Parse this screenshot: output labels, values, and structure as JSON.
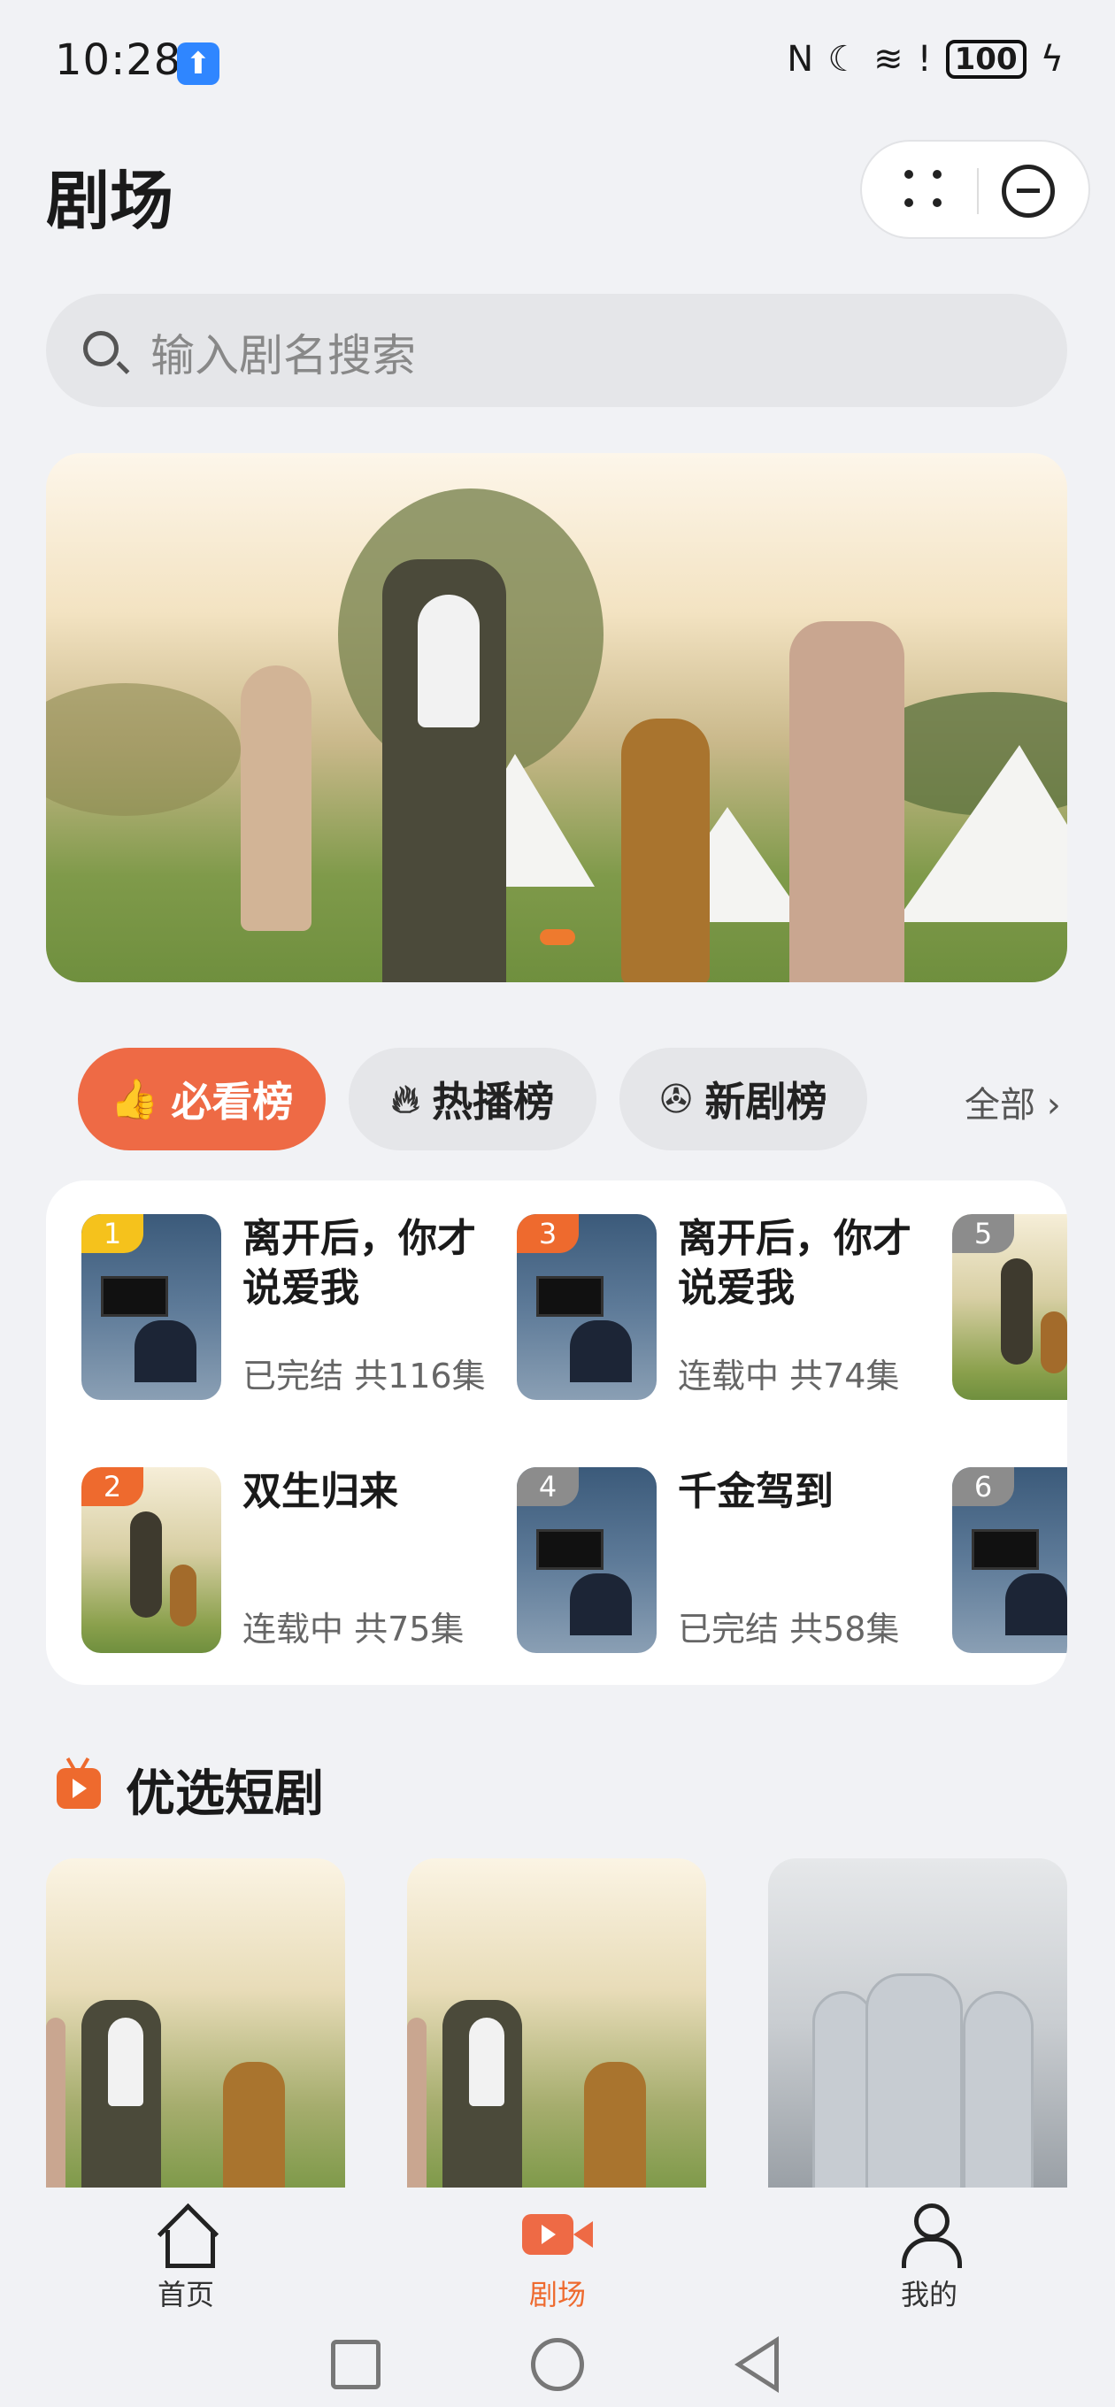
{
  "status_bar": {
    "time": "10:28",
    "battery": "100",
    "icons": [
      "upload-badge-icon",
      "nfc-icon",
      "moon-icon",
      "wifi-icon",
      "alert-icon",
      "battery-icon",
      "charging-icon"
    ]
  },
  "header": {
    "title": "剧场"
  },
  "search": {
    "placeholder": "输入剧名搜索"
  },
  "tabs": [
    {
      "label": "必看榜",
      "icon": "thumbs-up-icon",
      "active": true
    },
    {
      "label": "热播榜",
      "icon": "flame-icon",
      "active": false
    },
    {
      "label": "新剧榜",
      "icon": "film-reel-icon",
      "active": false
    }
  ],
  "all_link": "全部",
  "ranking": [
    {
      "rank": "1",
      "name": "离开后，你才说爱我",
      "meta": "已完结 共116集"
    },
    {
      "rank": "3",
      "name": "离开后，你才说爱我",
      "meta": "连载中 共74集"
    },
    {
      "rank": "5",
      "name": "",
      "meta": ""
    },
    {
      "rank": "2",
      "name": "双生归来",
      "meta": "连载中 共75集"
    },
    {
      "rank": "4",
      "name": "千金驾到",
      "meta": "已完结 共58集"
    },
    {
      "rank": "6",
      "name": "",
      "meta": ""
    }
  ],
  "section": {
    "title": "优选短剧"
  },
  "bottom_nav": [
    {
      "label": "首页",
      "icon": "home-icon"
    },
    {
      "label": "剧场",
      "icon": "video-camera-icon",
      "active": true
    },
    {
      "label": "我的",
      "icon": "user-icon"
    }
  ],
  "colors": {
    "accent": "#ee6a45",
    "background": "#f1f2f5",
    "rank_gold": "#f5c21c",
    "rank_gray": "#8c8c8c"
  }
}
